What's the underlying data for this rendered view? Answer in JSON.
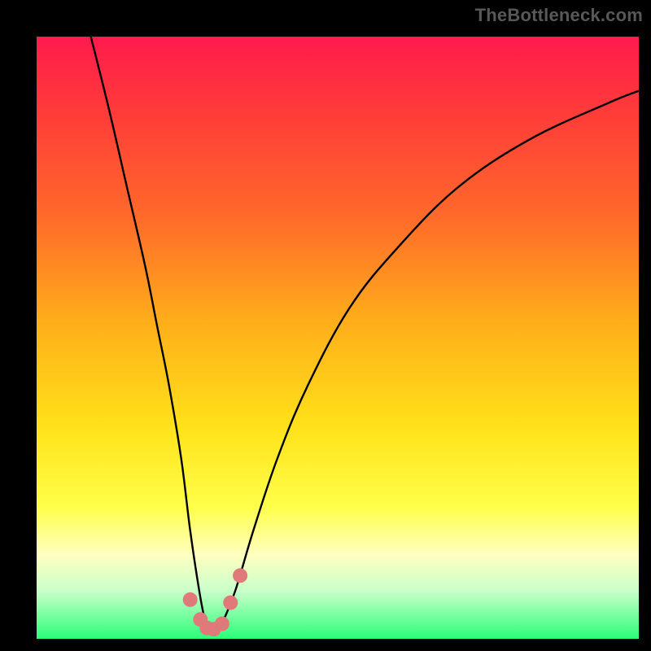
{
  "watermark": "TheBottleneck.com",
  "chart_data": {
    "type": "line",
    "title": "",
    "xlabel": "",
    "ylabel": "",
    "xlim": [
      0,
      100
    ],
    "ylim": [
      0,
      100
    ],
    "series": [
      {
        "name": "bottleneck-curve",
        "x": [
          9,
          12,
          15,
          18,
          20,
          22,
          24,
          25.5,
          27,
          28,
          29,
          30,
          31,
          33,
          36,
          40,
          45,
          52,
          60,
          70,
          82,
          95,
          100
        ],
        "values": [
          100,
          88,
          75,
          62,
          52,
          42,
          30,
          18,
          8,
          3,
          1,
          1,
          3,
          8,
          18,
          30,
          42,
          55,
          65,
          75,
          83,
          89,
          91
        ]
      }
    ],
    "markers": [
      {
        "x": 25.5,
        "y": 6.5
      },
      {
        "x": 27.2,
        "y": 3.2
      },
      {
        "x": 28.3,
        "y": 1.8
      },
      {
        "x": 29.4,
        "y": 1.6
      },
      {
        "x": 30.8,
        "y": 2.5
      },
      {
        "x": 32.2,
        "y": 6.0
      },
      {
        "x": 33.8,
        "y": 10.5
      }
    ],
    "marker_color": "#e07a7a",
    "curve_color": "#000000",
    "gradient_stops": [
      {
        "pct": 0,
        "color": "#ff1a4d"
      },
      {
        "pct": 12,
        "color": "#ff3a3a"
      },
      {
        "pct": 30,
        "color": "#ff6a2a"
      },
      {
        "pct": 48,
        "color": "#ffb01a"
      },
      {
        "pct": 65,
        "color": "#ffe21a"
      },
      {
        "pct": 78,
        "color": "#ffff4a"
      },
      {
        "pct": 86,
        "color": "#ffffc0"
      },
      {
        "pct": 92,
        "color": "#caffca"
      },
      {
        "pct": 100,
        "color": "#2bff7a"
      }
    ]
  }
}
